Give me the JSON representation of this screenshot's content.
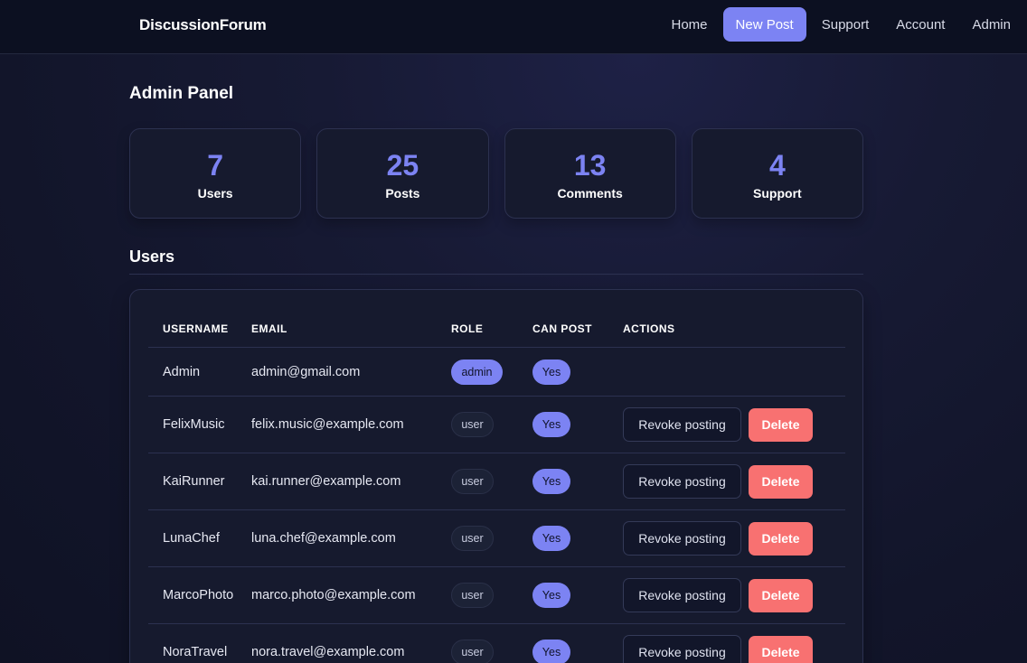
{
  "nav": {
    "brand": "DiscussionForum",
    "links": [
      {
        "label": "Home",
        "active": false
      },
      {
        "label": "New Post",
        "active": true
      },
      {
        "label": "Support",
        "active": false
      },
      {
        "label": "Account",
        "active": false
      },
      {
        "label": "Admin",
        "active": false
      }
    ]
  },
  "page": {
    "title": "Admin Panel"
  },
  "stats": [
    {
      "value": "7",
      "label": "Users"
    },
    {
      "value": "25",
      "label": "Posts"
    },
    {
      "value": "13",
      "label": "Comments"
    },
    {
      "value": "4",
      "label": "Support"
    }
  ],
  "users_section": {
    "title": "Users",
    "columns": [
      "USERNAME",
      "EMAIL",
      "ROLE",
      "CAN POST",
      "ACTIONS"
    ],
    "rows": [
      {
        "username": "Admin",
        "email": "admin@gmail.com",
        "role": "admin",
        "can_post": "Yes",
        "actions": []
      },
      {
        "username": "FelixMusic",
        "email": "felix.music@example.com",
        "role": "user",
        "can_post": "Yes",
        "actions": [
          "Revoke posting",
          "Delete"
        ]
      },
      {
        "username": "KaiRunner",
        "email": "kai.runner@example.com",
        "role": "user",
        "can_post": "Yes",
        "actions": [
          "Revoke posting",
          "Delete"
        ]
      },
      {
        "username": "LunaChef",
        "email": "luna.chef@example.com",
        "role": "user",
        "can_post": "Yes",
        "actions": [
          "Revoke posting",
          "Delete"
        ]
      },
      {
        "username": "MarcoPhoto",
        "email": "marco.photo@example.com",
        "role": "user",
        "can_post": "Yes",
        "actions": [
          "Revoke posting",
          "Delete"
        ]
      },
      {
        "username": "NoraTravel",
        "email": "nora.travel@example.com",
        "role": "user",
        "can_post": "Yes",
        "actions": [
          "Revoke posting",
          "Delete"
        ]
      }
    ]
  },
  "colors": {
    "accent": "#7c83f3",
    "danger": "#f87171",
    "background": "#12152a",
    "card": "#161a2e"
  }
}
